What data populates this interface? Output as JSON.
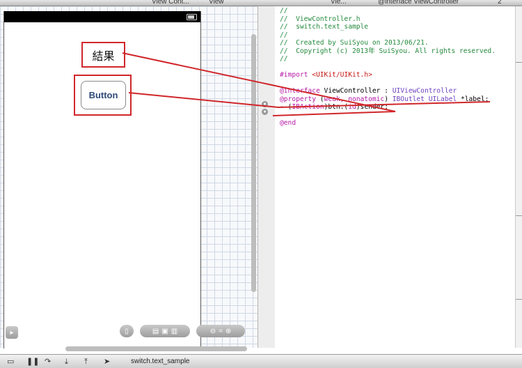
{
  "jump_bar": {
    "crumb_1": "View Cont...",
    "crumb_2": "View",
    "crumb_3": "Vie...",
    "crumb_4": "@interface ViewController",
    "counter": "2"
  },
  "canvas": {
    "label_text": "結果",
    "button_text": "Button"
  },
  "editor": {
    "lines": {
      "l1": "//",
      "l2": "//  ViewController.h",
      "l3": "//  switch.text_sample",
      "l4": "//",
      "l5": "//  Created by SuiSyou on 2013/06/21.",
      "l6": "//  Copyright (c) 2013年 SuiSyou. All rights reserved.",
      "l7": "//",
      "l9_kw": "#import ",
      "l9_str": "<UIKit/UIKit.h>",
      "l11_kw": "@interface",
      "l11_name": " ViewController : ",
      "l11_super": "UIViewController",
      "l12_kw": "@property",
      "l12_a": " (",
      "l12_attr": "weak, nonatomic",
      "l12_b": ") ",
      "l12_type": "IBOutlet UILabel",
      "l12_c": " *label;",
      "l13_a": "- (",
      "l13_type": "IBAction",
      "l13_b": ")btn:(",
      "l13_id": "id",
      "l13_c": ")sender;",
      "l15_kw": "@end"
    }
  },
  "debug_bar": {
    "scheme_label": "switch.text_sample"
  },
  "colors": {
    "annotation": "#d0262a",
    "comment": "#248a3c",
    "keyword": "#b418a5"
  }
}
